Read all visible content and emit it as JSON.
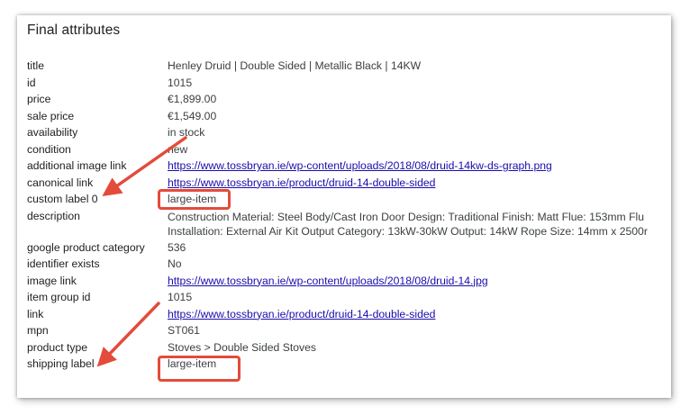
{
  "panel": {
    "title": "Final attributes"
  },
  "attributes": [
    {
      "key": "title",
      "value": "Henley Druid | Double Sided | Metallic Black | 14KW",
      "is_link": false
    },
    {
      "key": "id",
      "value": "1015",
      "is_link": false
    },
    {
      "key": "price",
      "value": "€1,899.00",
      "is_link": false
    },
    {
      "key": "sale price",
      "value": "€1,549.00",
      "is_link": false
    },
    {
      "key": "availability",
      "value": "in stock",
      "is_link": false
    },
    {
      "key": "condition",
      "value": "new",
      "is_link": false
    },
    {
      "key": "additional image link",
      "value": "https://www.tossbryan.ie/wp-content/uploads/2018/08/druid-14kw-ds-graph.png",
      "is_link": true
    },
    {
      "key": "canonical link",
      "value": "https://www.tossbryan.ie/product/druid-14-double-sided",
      "is_link": true
    },
    {
      "key": "custom label 0",
      "value": "large-item",
      "is_link": false
    },
    {
      "key": "description",
      "value_lines": [
        "Construction Material: Steel Body/Cast Iron Door Design: Traditional Finish: Matt Flue: 153mm Flu",
        "Installation: External Air Kit Output Category: 13kW-30kW Output: 14kW Rope Size: 14mm x 2500r"
      ],
      "is_link": false
    },
    {
      "key": "google product category",
      "value": "536",
      "is_link": false
    },
    {
      "key": "identifier exists",
      "value": "No",
      "is_link": false
    },
    {
      "key": "image link",
      "value": "https://www.tossbryan.ie/wp-content/uploads/2018/08/druid-14.jpg",
      "is_link": true
    },
    {
      "key": "item group id",
      "value": "1015",
      "is_link": false
    },
    {
      "key": "link",
      "value": "https://www.tossbryan.ie/product/druid-14-double-sided",
      "is_link": true
    },
    {
      "key": "mpn",
      "value": "ST061",
      "is_link": false
    },
    {
      "key": "product type",
      "value": "Stoves > Double Sided Stoves",
      "is_link": false
    },
    {
      "key": "shipping label",
      "value": "large-item",
      "is_link": false
    }
  ],
  "colors": {
    "highlight": "#e34b3b",
    "link": "#1a0dab"
  }
}
